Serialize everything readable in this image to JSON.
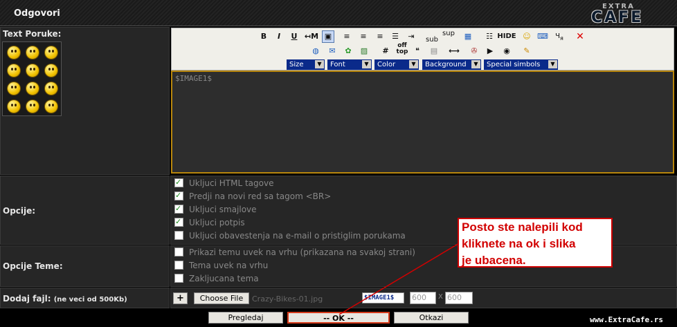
{
  "header": {
    "title": "Odgovori",
    "logo_top": "EXTRA",
    "logo_main": "CAFE"
  },
  "labels": {
    "text_poruke": "Text Poruke:",
    "opcije": "Opcije:",
    "opcije_teme": "Opcije Teme:",
    "dodaj_fajl": "Dodaj fajl:",
    "dodaj_fajl_note": "(ne veci od 500Kb)"
  },
  "toolbar": {
    "bold": "B",
    "italic": "I",
    "underline": "U",
    "arrow_m": "↤M",
    "sub": "sub",
    "sup": "sup",
    "hide": "HIDE",
    "hash": "#",
    "off": "off",
    "top": "top",
    "size": "Size",
    "font": "Font",
    "color": "Color",
    "background": "Background",
    "special": "Special simbols"
  },
  "editor": {
    "value": "$IMAGE1$"
  },
  "options": [
    {
      "label": "Ukljuci HTML tagove",
      "checked": true
    },
    {
      "label": "Predji na novi red sa tagom <BR>",
      "checked": true
    },
    {
      "label": "Ukljuci smajlove",
      "checked": true
    },
    {
      "label": "Ukljuci potpis",
      "checked": true
    },
    {
      "label": "Ukljuci obavestenja na e-mail o pristiglim porukama",
      "checked": false
    }
  ],
  "topic_options": [
    {
      "label": "Prikazi temu uvek na vrhu (prikazana na svakoj strani)",
      "checked": false
    },
    {
      "label": "Tema uvek na vrhu",
      "checked": false
    },
    {
      "label": "Zakljucana tema",
      "checked": false
    }
  ],
  "file": {
    "add": "+",
    "choose": "Choose File",
    "filename": "Crazy-Bikes-01.jpg",
    "tag": "$IMAGE1$",
    "width": "600",
    "x": "X",
    "height": "600"
  },
  "buttons": {
    "preview": "Pregledaj",
    "ok": "-- OK --",
    "cancel": "Otkazi"
  },
  "callout": {
    "line1": "Posto ste nalepili kod",
    "line2": "kliknete na ok i slika",
    "line3": "je ubacena."
  },
  "footer": {
    "url": "www.ExtraCafe.rs"
  },
  "colors": {
    "accent": "#b8860b",
    "callout": "#d20000",
    "link_blue": "#0a2a8a"
  }
}
